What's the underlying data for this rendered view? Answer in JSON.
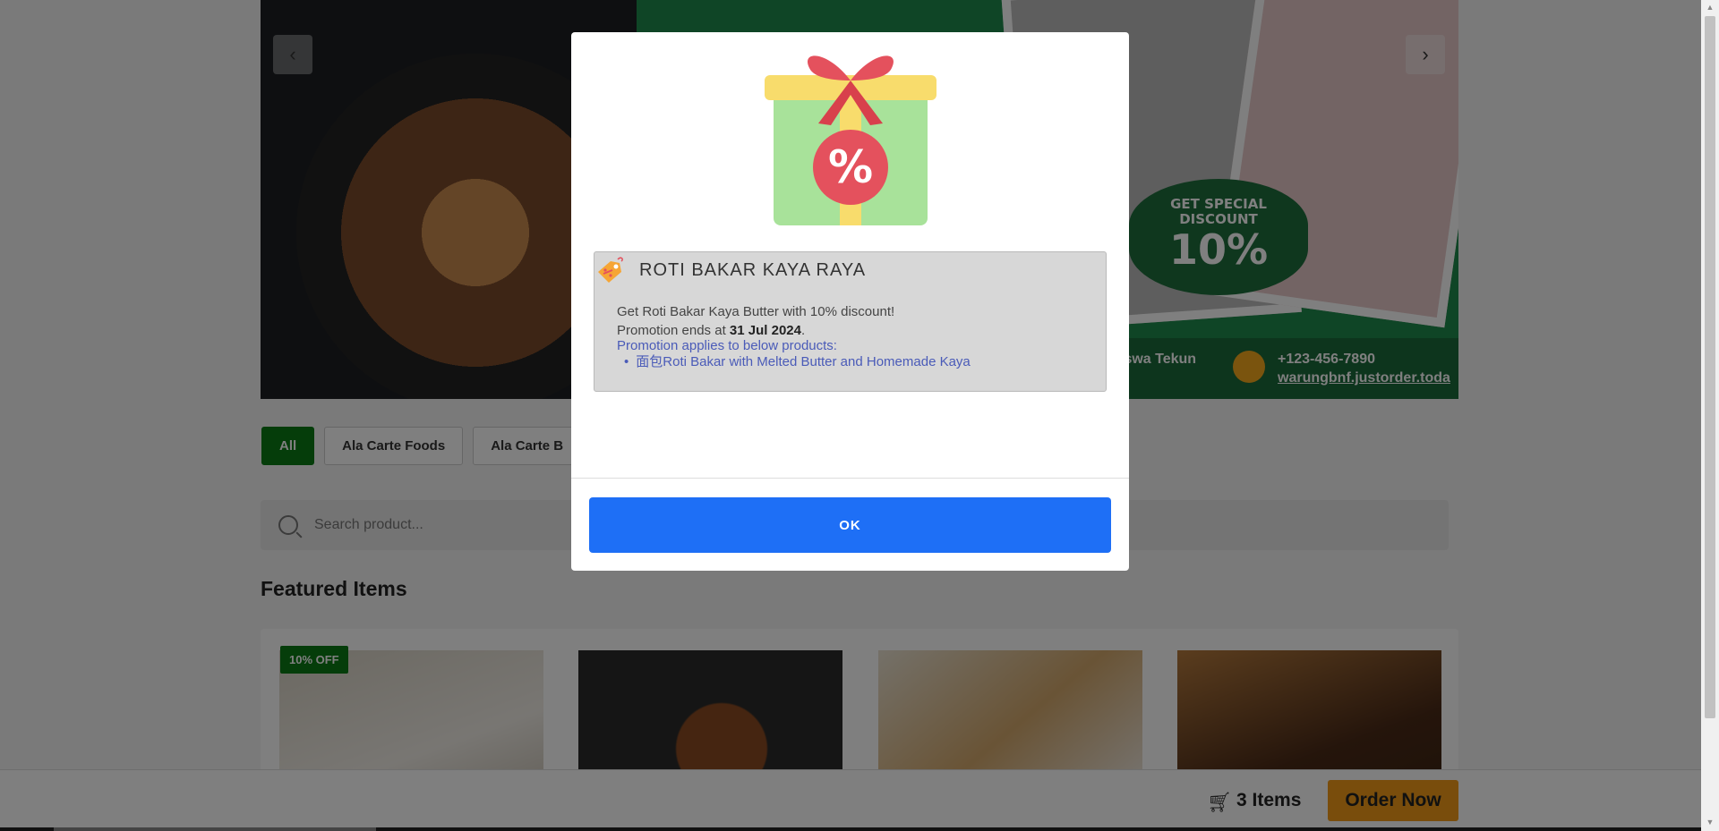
{
  "banner": {
    "discount_line1": "GET SPECIAL",
    "discount_line2": "DISCOUNT",
    "discount_value": "10%",
    "contact_name": "iswa Tekun",
    "phone": "+123-456-7890",
    "website": "warungbnf.justorder.toda"
  },
  "categories": [
    {
      "label": "All",
      "active": true
    },
    {
      "label": "Ala Carte Foods",
      "active": false
    },
    {
      "label": "Ala Carte B",
      "active": false
    }
  ],
  "search": {
    "placeholder": "Search product..."
  },
  "featured": {
    "title": "Featured Items",
    "badge": "10% OFF"
  },
  "cart": {
    "count_label": "3 Items",
    "order_label": "Order Now"
  },
  "modal": {
    "promo_title": "ROTI BAKAR KAYA RAYA",
    "promo_desc": "Get Roti Bakar Kaya Butter with 10% discount!",
    "ends_prefix": "Promotion ends at ",
    "ends_date": "31 Jul 2024",
    "ends_suffix": ".",
    "applies_label": "Promotion applies to below products:",
    "products": [
      "面包Roti Bakar with Melted Butter and Homemade Kaya"
    ],
    "ok_label": "OK"
  },
  "colors": {
    "accent_green": "#0a7a14",
    "ok_blue": "#1e6ff6",
    "order_orange": "#f29b18"
  }
}
